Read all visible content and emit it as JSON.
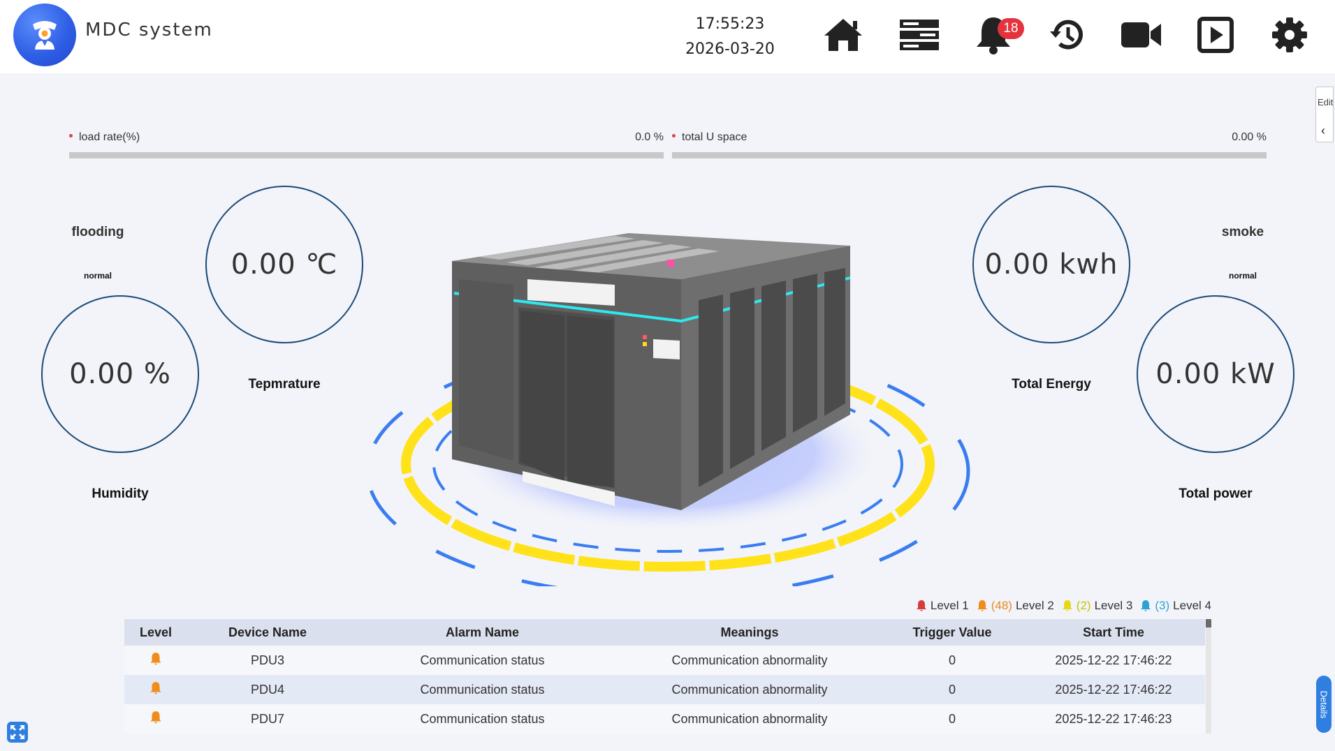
{
  "header": {
    "app_title": "MDC system",
    "time": "17:55:23",
    "date": "2026-03-20",
    "alarm_badge_count": "18",
    "nav_icons": [
      "home-icon",
      "server-list-icon",
      "bell-icon",
      "history-icon",
      "video-camera-icon",
      "playback-icon",
      "gear-icon"
    ]
  },
  "bars": {
    "load_rate": {
      "label": "load rate(%)",
      "value": "0.0 %",
      "fraction": 0.0
    },
    "total_u_space": {
      "label": "total U space",
      "value": "0.00 %",
      "fraction": 0.0
    }
  },
  "sensors": {
    "flooding": {
      "label": "flooding",
      "status": "normal"
    },
    "smoke": {
      "label": "smoke",
      "status": "normal"
    }
  },
  "gauges": {
    "humidity": {
      "value": "0.00 %",
      "label": "Humidity"
    },
    "temperature": {
      "value": "0.00 ℃",
      "label": "Tepmrature"
    },
    "energy": {
      "value": "0.00 kwh",
      "label": "Total Energy"
    },
    "power": {
      "value": "0.00 kW",
      "label": "Total power"
    }
  },
  "legend": {
    "level1": {
      "label": "Level 1",
      "count": "",
      "color": "#d93a3a"
    },
    "level2": {
      "label": "Level 2",
      "count": "(48)",
      "color": "#f08c1a"
    },
    "level3": {
      "label": "Level 3",
      "count": "(2)",
      "color": "#e3d91a"
    },
    "level4": {
      "label": "Level 4",
      "count": "(3)",
      "color": "#2aa3d4"
    }
  },
  "alarm_table": {
    "columns": [
      "Level",
      "Device Name",
      "Alarm Name",
      "Meanings",
      "Trigger Value",
      "Start Time"
    ],
    "rows": [
      {
        "level": "level2",
        "device": "PDU3",
        "alarm": "Communication status",
        "meaning": "Communication abnormality",
        "trigger": "0",
        "start": "2025-12-22 17:46:22"
      },
      {
        "level": "level2",
        "device": "PDU4",
        "alarm": "Communication status",
        "meaning": "Communication abnormality",
        "trigger": "0",
        "start": "2025-12-22 17:46:22"
      },
      {
        "level": "level2",
        "device": "PDU7",
        "alarm": "Communication status",
        "meaning": "Communication abnormality",
        "trigger": "0",
        "start": "2025-12-22 17:46:23"
      }
    ]
  },
  "side": {
    "edit_label": "Edit",
    "edit_chevron": "‹",
    "details_label": "Details"
  }
}
